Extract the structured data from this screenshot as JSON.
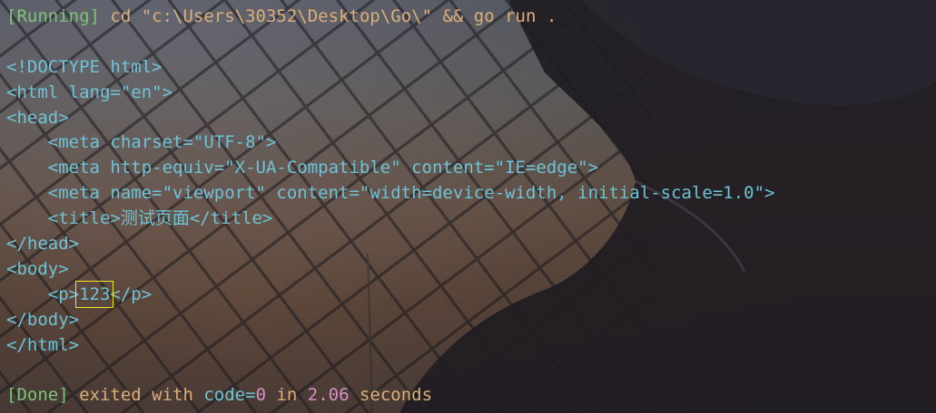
{
  "colors": {
    "status_green": "#7ec47a",
    "command_orange": "#dcae7a",
    "code_cyan": "#6ec3d6",
    "number_pink": "#d98fc4",
    "highlight_yellow": "#f2e62a"
  },
  "terminal": {
    "run_status": "[Running]",
    "run_command": "cd \"c:\\Users\\30352\\Desktop\\Go\\\" && go run .",
    "output_lines": [
      "<!DOCTYPE html>",
      "<html lang=\"en\">",
      "<head>",
      "    <meta charset=\"UTF-8\">",
      "    <meta http-equiv=\"X-UA-Compatible\" content=\"IE=edge\">",
      "    <meta name=\"viewport\" content=\"width=device-width, initial-scale=1.0\">",
      "    <title>测试页面</title>",
      "</head>",
      "<body>"
    ],
    "p_line": {
      "indent": "    ",
      "open_tag": "<p>",
      "content": "123",
      "close_tag": "</p>"
    },
    "closing_lines": [
      "</body>",
      "</html>"
    ],
    "done": {
      "status": "[Done]",
      "text_before": " exited with ",
      "code_label": "code=",
      "code_value": "0",
      "in_word": " in ",
      "duration": "2.06",
      "seconds_word": " seconds"
    }
  }
}
